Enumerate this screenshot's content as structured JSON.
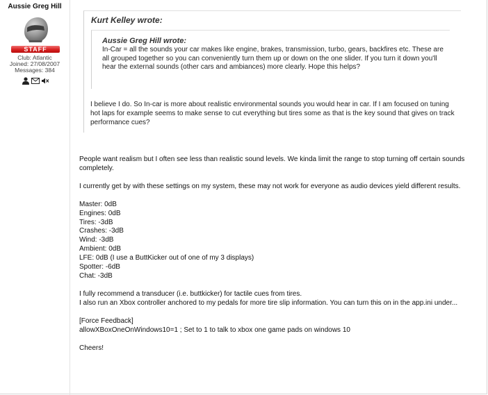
{
  "author": {
    "name": "Aussie Greg Hill",
    "badge": "STAFF",
    "club": "Club: Atlantic",
    "joined": "Joined: 27/08/2007",
    "messages": "Messages: 384",
    "icons": [
      "profile-icon",
      "message-icon",
      "mute-icon"
    ]
  },
  "quote": {
    "author": "Kurt Kelley wrote:",
    "nested": {
      "author": "Aussie Greg Hill wrote:",
      "text": "In-Car = all the sounds your car makes like engine, brakes, transmission, turbo, gears, backfires etc. These are all grouped together so you can conveniently turn them up or down on the one slider. If you turn it down you'll hear the external sounds (other cars and ambiances) more clearly. Hope this helps?"
    },
    "text": "I believe I do. So In-car is more about realistic environmental sounds you would hear in car. If I am focused on tuning hot laps for example seems to make sense to cut everything but tires some as that is the key sound that gives on track performance cues?"
  },
  "post": {
    "para1": "People want realism but I often see less than realistic sound levels. We kinda limit the range to stop turning off certain sounds completely.",
    "para2": "I currently get by with these settings on my system, these may not work for everyone as audio devices yield different results.",
    "settings": [
      "Master: 0dB",
      "Engines: 0dB",
      "Tires: -3dB",
      "Crashes: -3dB",
      "Wind: -3dB",
      "Ambient: 0dB",
      "LFE: 0dB (I use a ButtKicker out of one of my 3 displays)",
      "Spotter: -6dB",
      "Chat: -3dB"
    ],
    "para3a": "I fully recommend a transducer (i.e. buttkicker) for tactile cues from tires.",
    "para3b": "I also run an Xbox controller anchored to my pedals for more tire slip information. You can turn this on in the app.ini under...",
    "ini_section": "[Force Feedback]",
    "ini_line": "allowXBoxOneOnWindows10=1 ; Set to 1 to talk to xbox one game pads on windows 10",
    "signoff": "Cheers!"
  }
}
